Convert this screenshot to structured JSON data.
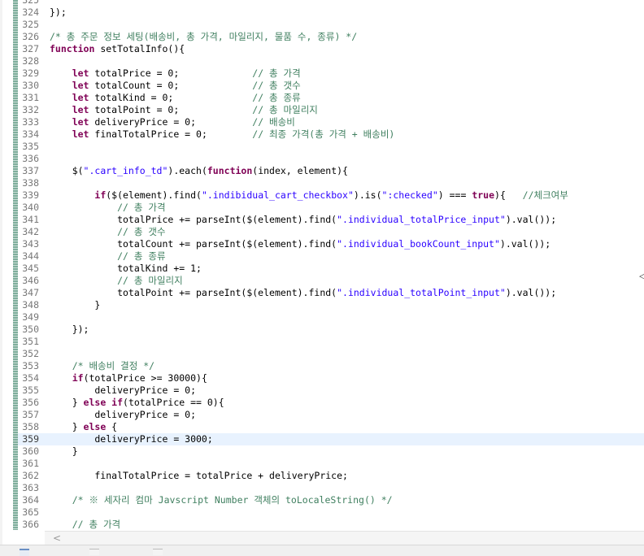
{
  "editor": {
    "current_line": "359",
    "lines": [
      {
        "num": "325",
        "parts": []
      },
      {
        "num": "324",
        "parts": [
          {
            "t": "});",
            "c": ""
          }
        ]
      },
      {
        "num": "325",
        "parts": []
      },
      {
        "num": "326",
        "parts": [
          {
            "t": "/* 총 주문 정보 세팅(배송비, 총 가격, 마일리지, 물품 수, 종류) */",
            "c": "cmt"
          }
        ]
      },
      {
        "num": "327",
        "parts": [
          {
            "t": "function",
            "c": "kw"
          },
          {
            "t": " setTotalInfo(){",
            "c": ""
          }
        ]
      },
      {
        "num": "328",
        "parts": []
      },
      {
        "num": "329",
        "parts": [
          {
            "t": "    ",
            "c": ""
          },
          {
            "t": "let",
            "c": "kw"
          },
          {
            "t": " totalPrice = 0;             ",
            "c": ""
          },
          {
            "t": "// 총 가격",
            "c": "cmt"
          }
        ]
      },
      {
        "num": "330",
        "parts": [
          {
            "t": "    ",
            "c": ""
          },
          {
            "t": "let",
            "c": "kw"
          },
          {
            "t": " totalCount = 0;             ",
            "c": ""
          },
          {
            "t": "// 총 갯수",
            "c": "cmt"
          }
        ]
      },
      {
        "num": "331",
        "parts": [
          {
            "t": "    ",
            "c": ""
          },
          {
            "t": "let",
            "c": "kw"
          },
          {
            "t": " totalKind = 0;              ",
            "c": ""
          },
          {
            "t": "// 총 종류",
            "c": "cmt"
          }
        ]
      },
      {
        "num": "332",
        "parts": [
          {
            "t": "    ",
            "c": ""
          },
          {
            "t": "let",
            "c": "kw"
          },
          {
            "t": " totalPoint = 0;             ",
            "c": ""
          },
          {
            "t": "// 총 마일리지",
            "c": "cmt"
          }
        ]
      },
      {
        "num": "333",
        "parts": [
          {
            "t": "    ",
            "c": ""
          },
          {
            "t": "let",
            "c": "kw"
          },
          {
            "t": " deliveryPrice = 0;          ",
            "c": ""
          },
          {
            "t": "// 배송비",
            "c": "cmt"
          }
        ]
      },
      {
        "num": "334",
        "parts": [
          {
            "t": "    ",
            "c": ""
          },
          {
            "t": "let",
            "c": "kw"
          },
          {
            "t": " finalTotalPrice = 0;        ",
            "c": ""
          },
          {
            "t": "// 최종 가격(총 가격 + 배송비)",
            "c": "cmt"
          }
        ]
      },
      {
        "num": "335",
        "parts": []
      },
      {
        "num": "336",
        "parts": []
      },
      {
        "num": "337",
        "parts": [
          {
            "t": "    $(",
            "c": ""
          },
          {
            "t": "\".cart_info_td\"",
            "c": "str"
          },
          {
            "t": ").each(",
            "c": ""
          },
          {
            "t": "function",
            "c": "kw"
          },
          {
            "t": "(index, element){",
            "c": ""
          }
        ]
      },
      {
        "num": "338",
        "parts": []
      },
      {
        "num": "339",
        "parts": [
          {
            "t": "        ",
            "c": ""
          },
          {
            "t": "if",
            "c": "kw"
          },
          {
            "t": "($(element).find(",
            "c": ""
          },
          {
            "t": "\".indibidual_cart_checkbox\"",
            "c": "str"
          },
          {
            "t": ").is(",
            "c": ""
          },
          {
            "t": "\":checked\"",
            "c": "str"
          },
          {
            "t": ") === ",
            "c": ""
          },
          {
            "t": "true",
            "c": "kw"
          },
          {
            "t": "){   ",
            "c": ""
          },
          {
            "t": "//체크여부",
            "c": "cmt"
          }
        ]
      },
      {
        "num": "340",
        "parts": [
          {
            "t": "            ",
            "c": ""
          },
          {
            "t": "// 총 가격",
            "c": "cmt"
          }
        ]
      },
      {
        "num": "341",
        "parts": [
          {
            "t": "            totalPrice += parseInt($(element).find(",
            "c": ""
          },
          {
            "t": "\".individual_totalPrice_input\"",
            "c": "str"
          },
          {
            "t": ").val());",
            "c": ""
          }
        ]
      },
      {
        "num": "342",
        "parts": [
          {
            "t": "            ",
            "c": ""
          },
          {
            "t": "// 총 갯수",
            "c": "cmt"
          }
        ]
      },
      {
        "num": "343",
        "parts": [
          {
            "t": "            totalCount += parseInt($(element).find(",
            "c": ""
          },
          {
            "t": "\".individual_bookCount_input\"",
            "c": "str"
          },
          {
            "t": ").val());",
            "c": ""
          }
        ]
      },
      {
        "num": "344",
        "parts": [
          {
            "t": "            ",
            "c": ""
          },
          {
            "t": "// 총 종류",
            "c": "cmt"
          }
        ]
      },
      {
        "num": "345",
        "parts": [
          {
            "t": "            totalKind += 1;",
            "c": ""
          }
        ]
      },
      {
        "num": "346",
        "parts": [
          {
            "t": "            ",
            "c": ""
          },
          {
            "t": "// 총 마일리지",
            "c": "cmt"
          }
        ]
      },
      {
        "num": "347",
        "parts": [
          {
            "t": "            totalPoint += parseInt($(element).find(",
            "c": ""
          },
          {
            "t": "\".individual_totalPoint_input\"",
            "c": "str"
          },
          {
            "t": ").val());",
            "c": ""
          }
        ]
      },
      {
        "num": "348",
        "parts": [
          {
            "t": "        }",
            "c": ""
          }
        ]
      },
      {
        "num": "349",
        "parts": []
      },
      {
        "num": "350",
        "parts": [
          {
            "t": "    });",
            "c": ""
          }
        ]
      },
      {
        "num": "351",
        "parts": []
      },
      {
        "num": "352",
        "parts": []
      },
      {
        "num": "353",
        "parts": [
          {
            "t": "    ",
            "c": ""
          },
          {
            "t": "/* 배송비 결정 */",
            "c": "cmt"
          }
        ]
      },
      {
        "num": "354",
        "parts": [
          {
            "t": "    ",
            "c": ""
          },
          {
            "t": "if",
            "c": "kw"
          },
          {
            "t": "(totalPrice >= 30000){",
            "c": ""
          }
        ]
      },
      {
        "num": "355",
        "parts": [
          {
            "t": "        deliveryPrice = 0;",
            "c": ""
          }
        ]
      },
      {
        "num": "356",
        "parts": [
          {
            "t": "    } ",
            "c": ""
          },
          {
            "t": "else if",
            "c": "kw"
          },
          {
            "t": "(totalPrice == 0){",
            "c": ""
          }
        ]
      },
      {
        "num": "357",
        "parts": [
          {
            "t": "        deliveryPrice = 0;",
            "c": ""
          }
        ]
      },
      {
        "num": "358",
        "parts": [
          {
            "t": "    } ",
            "c": ""
          },
          {
            "t": "else",
            "c": "kw"
          },
          {
            "t": " {",
            "c": ""
          }
        ]
      },
      {
        "num": "359",
        "parts": [
          {
            "t": "        deliveryPrice = 3000;",
            "c": ""
          }
        ]
      },
      {
        "num": "360",
        "parts": [
          {
            "t": "    }",
            "c": ""
          }
        ]
      },
      {
        "num": "361",
        "parts": []
      },
      {
        "num": "362",
        "parts": [
          {
            "t": "        finalTotalPrice = totalPrice + deliveryPrice;",
            "c": ""
          }
        ]
      },
      {
        "num": "363",
        "parts": []
      },
      {
        "num": "364",
        "parts": [
          {
            "t": "    ",
            "c": ""
          },
          {
            "t": "/* ※ 세자리 컴마 Javscript Number 객체의 toLocaleString() */",
            "c": "cmt"
          }
        ]
      },
      {
        "num": "365",
        "parts": []
      },
      {
        "num": "366",
        "parts": [
          {
            "t": "    ",
            "c": ""
          },
          {
            "t": "// 총 가격",
            "c": "cmt"
          }
        ]
      }
    ]
  },
  "scrollbar": {
    "left_arrow": "<"
  },
  "overview_marker": "◁",
  "colors": {
    "keyword": "#7f0055",
    "string": "#2a00ff",
    "comment": "#3f7f5f",
    "current_line_bg": "#e8f2fe"
  }
}
